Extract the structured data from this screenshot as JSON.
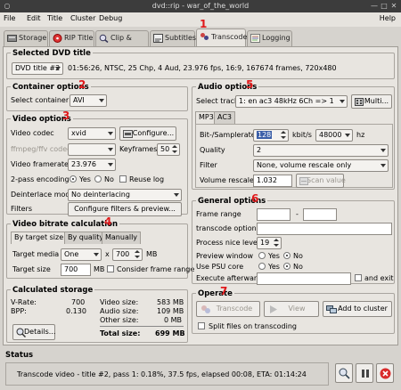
{
  "window": {
    "title": "dvd::rip - war_of_the_world"
  },
  "menu": [
    "File",
    "Edit",
    "Title",
    "Cluster",
    "Debug"
  ],
  "help_label": "Help",
  "tabs": [
    "Storage",
    "RIP Title",
    "Clip & Zoom",
    "Subtitles",
    "Transcode",
    "Logging"
  ],
  "annotations": [
    "1",
    "2",
    "3",
    "4",
    "5",
    "6",
    "7"
  ],
  "selected_title": {
    "heading": "Selected DVD title",
    "combo": "DVD title #2",
    "info": "01:56:26, NTSC, 25 Chp, 4 Aud, 23.976 fps, 16:9, 167674 frames, 720x480"
  },
  "container": {
    "heading": "Container options",
    "label": "Select container",
    "value": "AVI"
  },
  "video": {
    "heading": "Video options",
    "codec_label": "Video codec",
    "codec_value": "xvid",
    "configure_label": "Configure...",
    "ffmpeg_label": "ffmpeg/ffv codec",
    "keyframes_label": "Keyframes",
    "keyframes_value": "50",
    "framerate_label": "Video framerate",
    "framerate_value": "23.976",
    "twopass_label": "2-pass encoding",
    "yes": "Yes",
    "no": "No",
    "reuse_label": "Reuse log",
    "deinterlace_label": "Deinterlace mode",
    "deinterlace_value": "No deinterlacing",
    "filters_label": "Filters",
    "filters_button": "Configure filters & preview..."
  },
  "bitrate": {
    "heading": "Video bitrate calculation",
    "tabs": [
      "By target size",
      "By quality",
      "Manually"
    ],
    "target_media_label": "Target media",
    "media_value": "One",
    "x": "x",
    "size_value": "700",
    "mb": "MB",
    "target_size_label": "Target size",
    "target_size_value": "700",
    "consider_label": "Consider frame range"
  },
  "storage": {
    "heading": "Calculated storage",
    "vrate_label": "V-Rate:",
    "vrate_value": "700",
    "bpp_label": "BPP:",
    "bpp_value": "0.130",
    "video_size_label": "Video size:",
    "video_size_value": "583 MB",
    "audio_size_label": "Audio size:",
    "audio_size_value": "109 MB",
    "other_size_label": "Other size:",
    "other_size_value": "0 MB",
    "total_label": "Total size:",
    "total_value": "699 MB",
    "details_label": "Details..."
  },
  "audio": {
    "heading": "Audio options",
    "track_label": "Select track",
    "track_value": "1: en ac3 48kHz 6Ch => 1",
    "multi_label": "Multi...",
    "tabs": [
      "MP3",
      "AC3"
    ],
    "bitrate_label": "Bit-/Samplerate",
    "bitrate_value": "128",
    "kbits": "kbit/s",
    "sample_value": "48000",
    "hz": "hz",
    "quality_label": "Quality",
    "quality_value": "2",
    "filter_label": "Filter",
    "filter_value": "None, volume rescale only",
    "volume_label": "Volume rescale",
    "volume_value": "1.032",
    "scan_label": "Scan value"
  },
  "general": {
    "heading": "General options",
    "frame_range_label": "Frame range",
    "dash": "-",
    "transcode_options_label": "transcode options",
    "nice_label": "Process nice level",
    "nice_value": "19",
    "preview_label": "Preview window",
    "psu_label": "Use PSU core",
    "exec_label": "Execute afterwards",
    "and_exit_label": "and exit",
    "yes": "Yes",
    "no": "No"
  },
  "operate": {
    "heading": "Operate",
    "transcode_label": "Transcode",
    "view_label": "View",
    "add_cluster_label": "Add to cluster",
    "split_label": "Split files on transcoding"
  },
  "status": {
    "heading": "Status",
    "text": "Transcode video - title #2, pass 1: 0.18%, 37.5 fps, elapsed 00:08, ETA: 01:14:24"
  }
}
